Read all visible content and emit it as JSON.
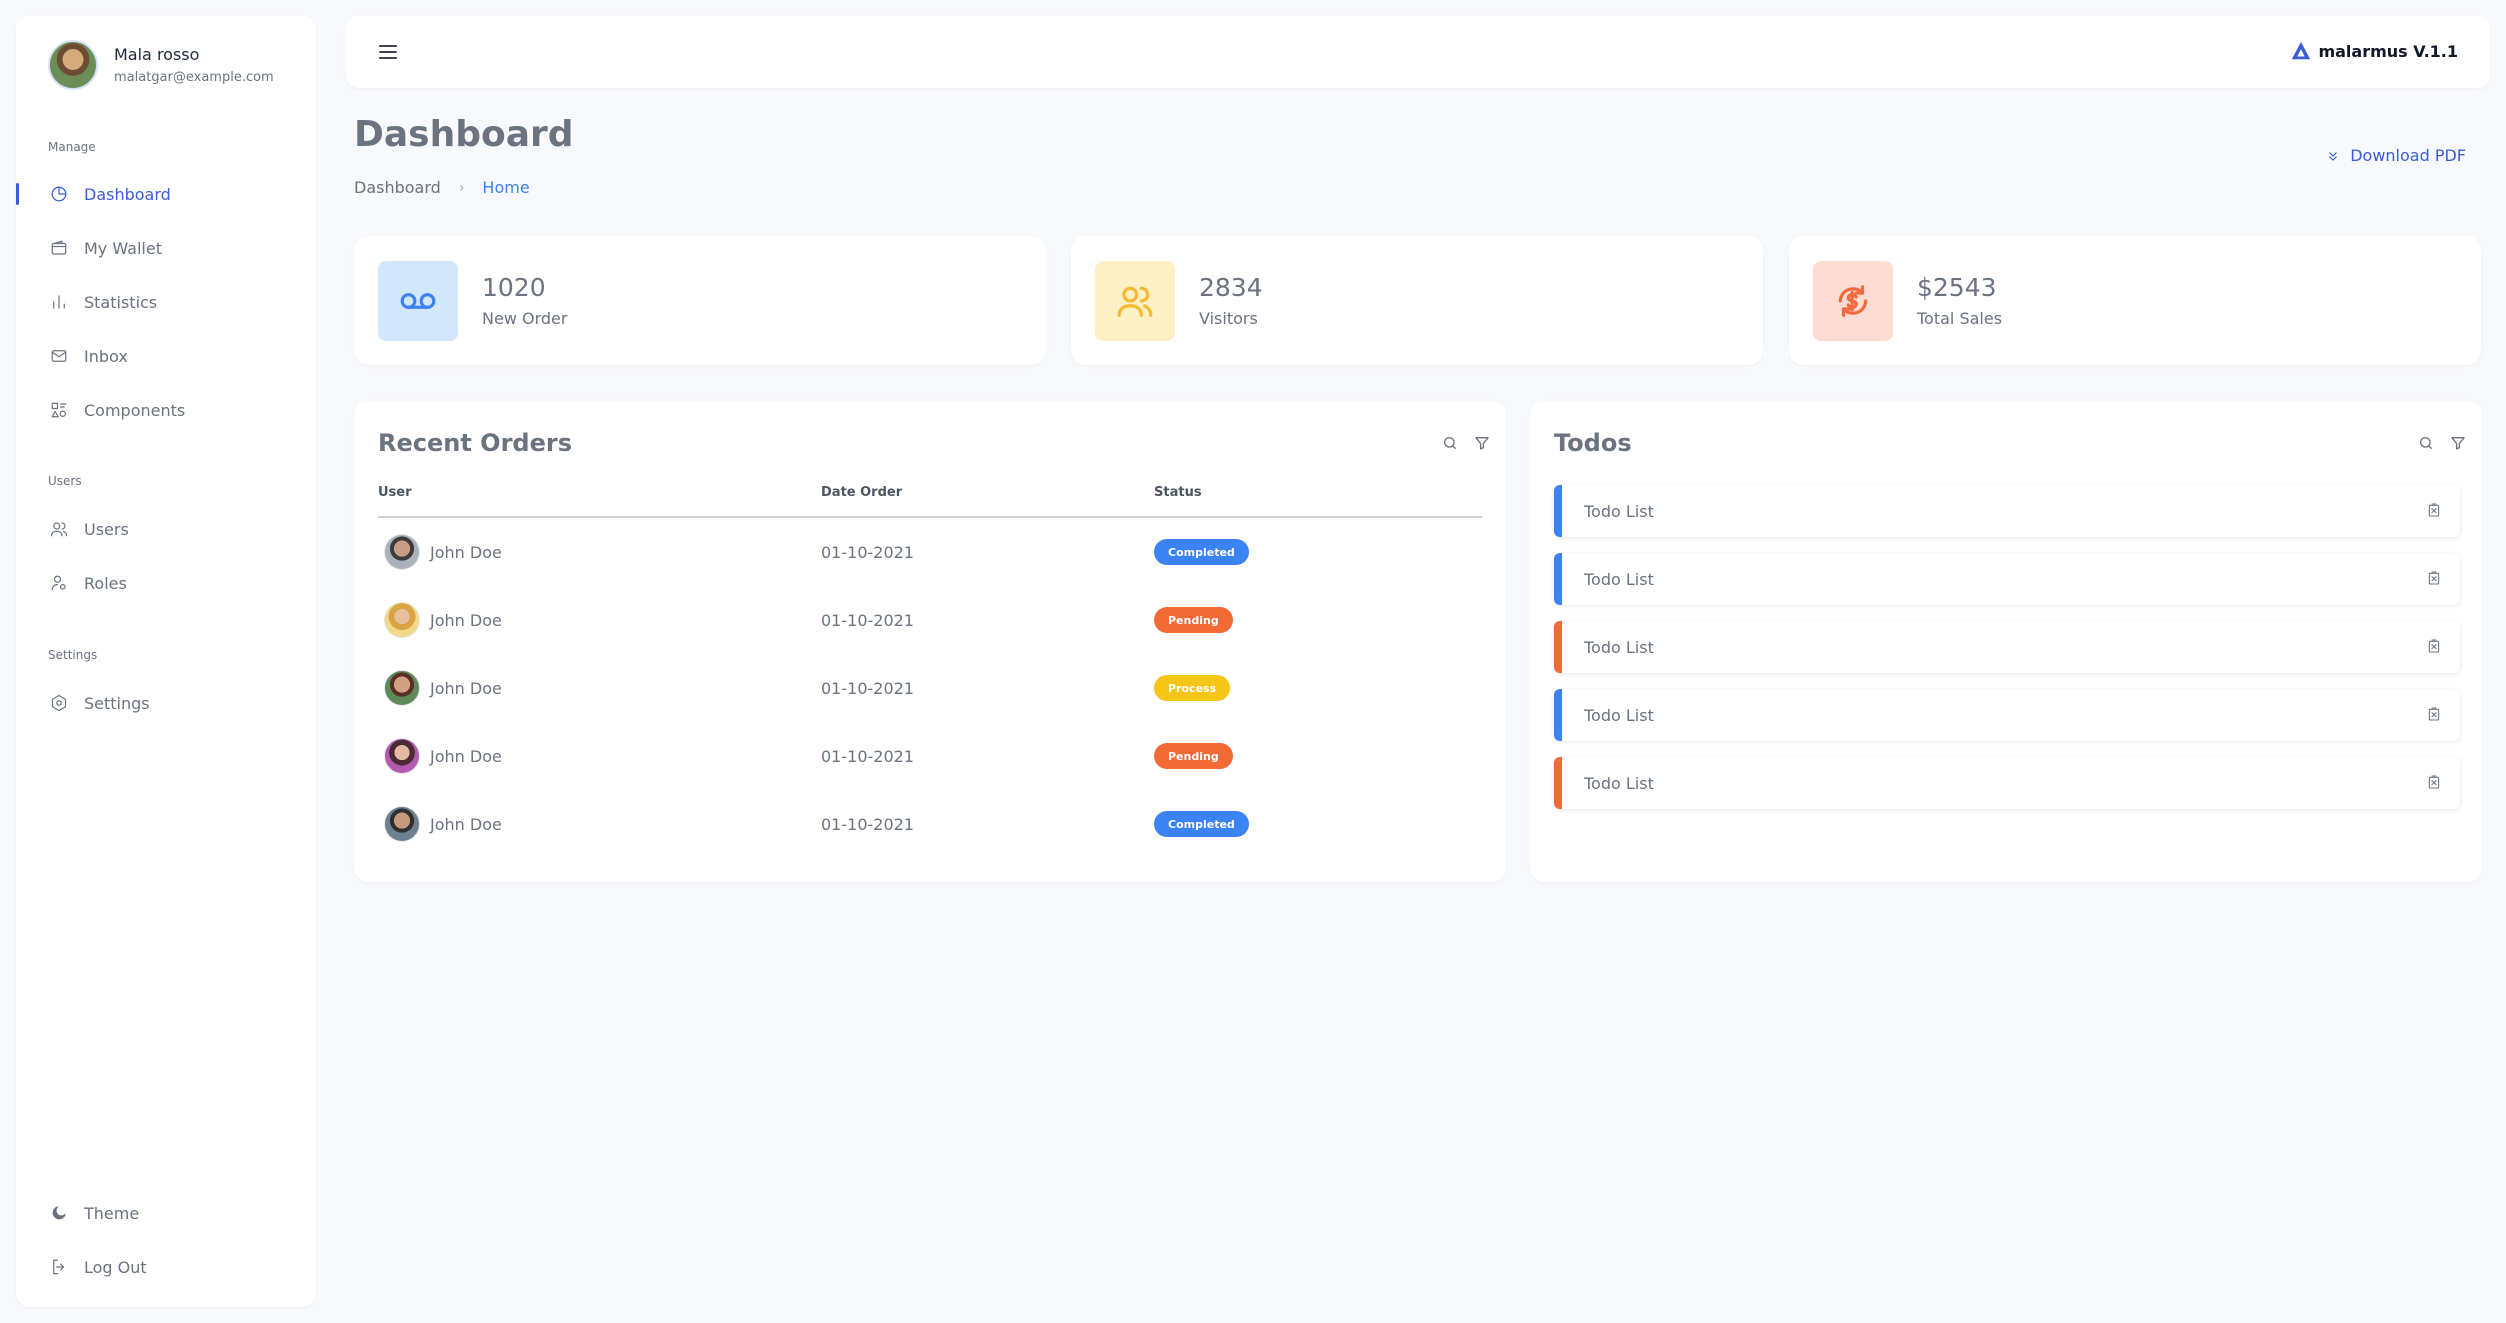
{
  "sidebar": {
    "user": {
      "name": "Mala rosso",
      "email": "malatgar@example.com"
    },
    "sections": {
      "manage": "Manage",
      "users": "Users",
      "settings": "Settings"
    },
    "items": [
      {
        "label": "Dashboard",
        "icon": "pie-chart-icon",
        "active": true
      },
      {
        "label": "My Wallet",
        "icon": "wallet-icon"
      },
      {
        "label": "Statistics",
        "icon": "bar-chart-icon"
      },
      {
        "label": "Inbox",
        "icon": "mail-icon"
      },
      {
        "label": "Components",
        "icon": "shapes-icon"
      },
      {
        "label": "Users",
        "icon": "users-icon"
      },
      {
        "label": "Roles",
        "icon": "user-role-icon"
      },
      {
        "label": "Settings",
        "icon": "settings-icon"
      }
    ],
    "footer": {
      "theme": "Theme",
      "logout": "Log Out"
    }
  },
  "topbar": {
    "brand": "malarmus V.1.1"
  },
  "page": {
    "title": "Dashboard",
    "breadcrumb": [
      "Dashboard",
      "Home"
    ],
    "download": "Download PDF"
  },
  "stats": [
    {
      "value": "1020",
      "label": "New Order",
      "icon": "voicemail-icon",
      "bg": "#d3e7fb",
      "color": "#3b82f6"
    },
    {
      "value": "2834",
      "label": "Visitors",
      "icon": "users-icon",
      "bg": "#fdf0c4",
      "color": "#f5b82e"
    },
    {
      "value": "$2543",
      "label": "Total Sales",
      "icon": "dollar-cycle-icon",
      "bg": "#fddcd3",
      "color": "#f2683f"
    }
  ],
  "orders": {
    "title": "Recent Orders",
    "columns": [
      "User",
      "Date Order",
      "Status"
    ],
    "rows": [
      {
        "user": "John Doe",
        "date": "01-10-2021",
        "status": "Completed",
        "color": "#3b82f6"
      },
      {
        "user": "John Doe",
        "date": "01-10-2021",
        "status": "Pending",
        "color": "#f26b35"
      },
      {
        "user": "John Doe",
        "date": "01-10-2021",
        "status": "Process",
        "color": "#f5c518"
      },
      {
        "user": "John Doe",
        "date": "01-10-2021",
        "status": "Pending",
        "color": "#f26b35"
      },
      {
        "user": "John Doe",
        "date": "01-10-2021",
        "status": "Completed",
        "color": "#3b82f6"
      }
    ]
  },
  "todos": {
    "title": "Todos",
    "items": [
      {
        "text": "Todo List",
        "color": "#3b82f6"
      },
      {
        "text": "Todo List",
        "color": "#3b82f6"
      },
      {
        "text": "Todo List",
        "color": "#f26b35"
      },
      {
        "text": "Todo List",
        "color": "#3b82f6"
      },
      {
        "text": "Todo List",
        "color": "#f26b35"
      }
    ]
  }
}
